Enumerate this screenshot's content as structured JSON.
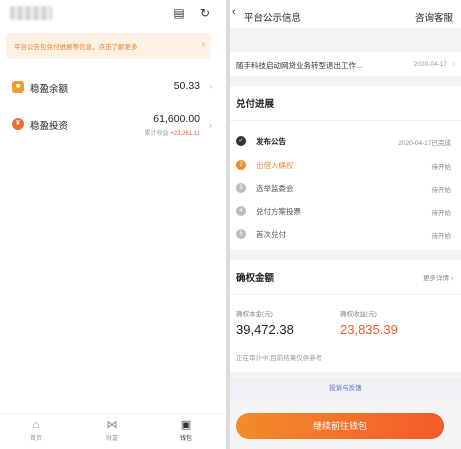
{
  "left": {
    "notice": "平台公告包兑付进展等信息，点击了解更多",
    "rows": [
      {
        "label": "稳盈余额",
        "value": "50.33",
        "icon_letter": "■",
        "icon_color": "#f39a32"
      },
      {
        "label": "稳盈投资",
        "value": "61,600.00",
        "sub_label": "累计收益",
        "sub_value": "+23,261.11",
        "icon_letter": "¥",
        "icon_color": "#f06b2c"
      }
    ],
    "tabs": [
      {
        "icon": "⌂",
        "label": "首页"
      },
      {
        "icon": "⋈",
        "label": "财富"
      },
      {
        "icon": "▣",
        "label": "钱包"
      }
    ]
  },
  "right": {
    "header": {
      "title": "平台公示信息",
      "action": "咨询客服"
    },
    "news": {
      "text": "随手科技启动网贷业务转型退出工作...",
      "date": "2020-04-17"
    },
    "progress": {
      "title": "兑付进展",
      "steps": [
        {
          "label": "发布公告",
          "status": "2020-04-17已完成",
          "state": "done"
        },
        {
          "label": "出借人确权",
          "status": "待开始",
          "state": "active"
        },
        {
          "label": "选举监委会",
          "status": "待开始",
          "state": "pending",
          "num": "3"
        },
        {
          "label": "兑付方案投票",
          "status": "待开始",
          "state": "pending",
          "num": "4"
        },
        {
          "label": "首次兑付",
          "status": "待开始",
          "state": "pending",
          "num": "5"
        }
      ]
    },
    "amount": {
      "title": "确权金额",
      "more": "更多详情",
      "principal_label": "确权本金(元)",
      "principal_value": "39,472.38",
      "interest_label": "确权收益(元)",
      "interest_value": "23,835.39",
      "note": "正在审计中,目前结果仅供参考"
    },
    "feedback": "投诉与反馈",
    "cta": "继续前往钱包"
  }
}
